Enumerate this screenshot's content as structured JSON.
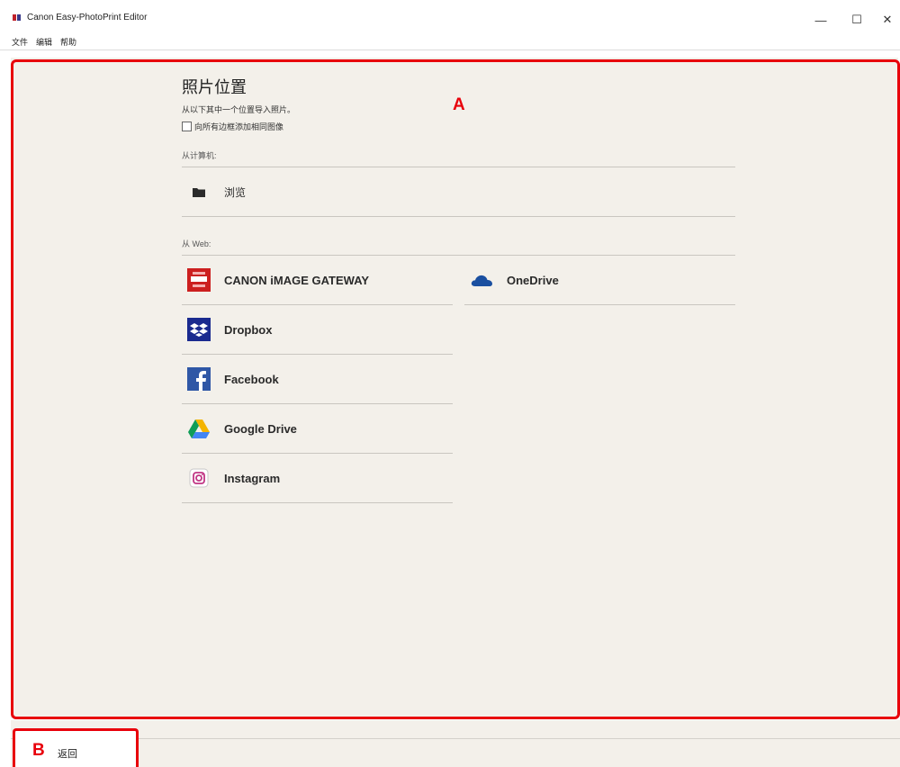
{
  "window": {
    "title": "Canon Easy-PhotoPrint Editor",
    "minimize": "—",
    "maximize": "☐",
    "close": "✕"
  },
  "menu": [
    "文件",
    "编辑",
    "帮助"
  ],
  "panel": {
    "title": "照片位置",
    "instruction": "从以下其中一个位置导入照片。",
    "checkbox_label": "向所有边框添加相同图像",
    "checkbox_checked": false,
    "from_computer_label": "从计算机:",
    "browse_label": "浏览",
    "from_web_label": "从 Web:",
    "left_services": [
      "CANON iMAGE GATEWAY",
      "Dropbox",
      "Facebook",
      "Google Drive",
      "Instagram"
    ],
    "right_services": [
      "OneDrive"
    ]
  },
  "annotations": {
    "a": "A",
    "b": "B"
  },
  "footer": {
    "back_label": "返回"
  },
  "colors": {
    "highlight": "#e8000b",
    "panel_bg": "#f3f0ea"
  }
}
